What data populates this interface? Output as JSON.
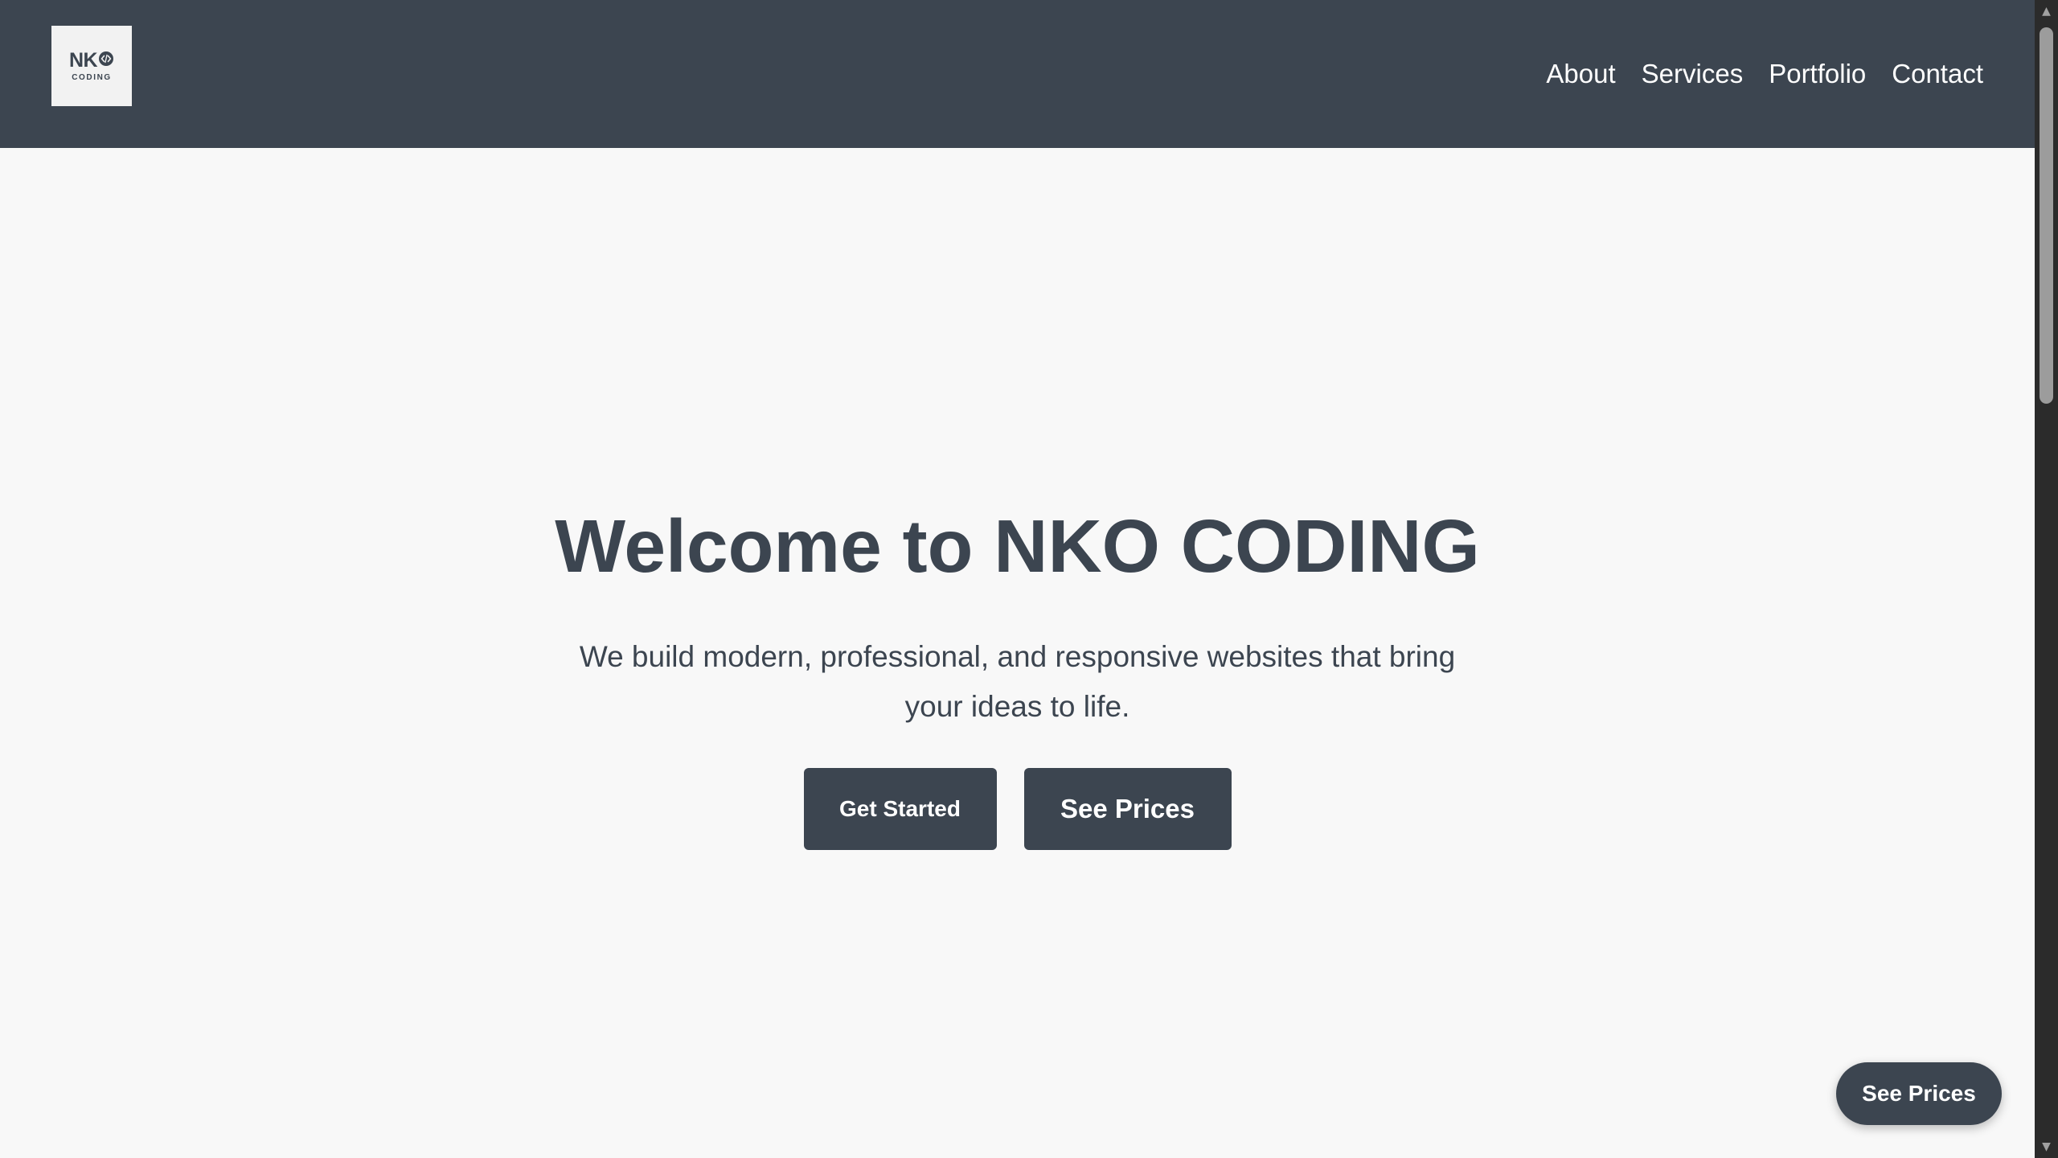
{
  "header": {
    "logo": {
      "main": "NK",
      "sub": "CODING",
      "mark_icon": "code-brackets-icon"
    },
    "nav": [
      {
        "label": "About"
      },
      {
        "label": "Services"
      },
      {
        "label": "Portfolio"
      },
      {
        "label": "Contact"
      }
    ]
  },
  "hero": {
    "title": "Welcome to NKO CODING",
    "subtitle": "We build modern, professional, and responsive websites that bring your ideas to life.",
    "primary_button": "Get Started",
    "secondary_button": "See Prices"
  },
  "floating_button": {
    "label": "See Prices"
  },
  "colors": {
    "primary": "#3c4550",
    "background": "#f8f8f8",
    "logo_background": "#f2f2f2",
    "text_light": "#ffffff"
  }
}
